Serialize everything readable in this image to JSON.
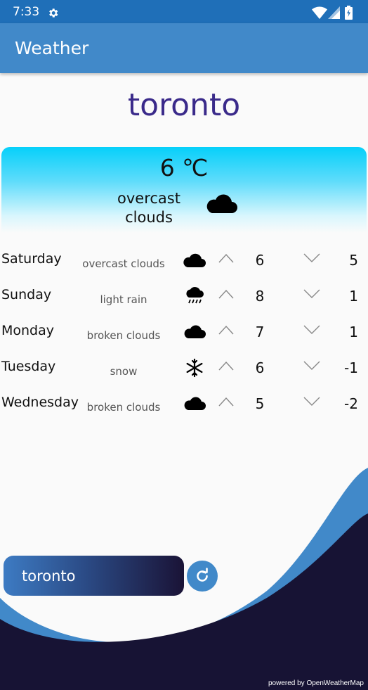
{
  "status_bar": {
    "time": "7:33",
    "icons": [
      "gear-icon",
      "wifi-icon",
      "signal-icon",
      "battery-icon"
    ]
  },
  "app_bar": {
    "title": "Weather"
  },
  "city": "toronto",
  "current": {
    "temperature": "6 ℃",
    "description": "overcast\nclouds",
    "icon": "cloud-icon"
  },
  "forecast": [
    {
      "day": "Saturday",
      "description": "overcast clouds",
      "icon": "cloud-icon",
      "high": "6",
      "low": "5"
    },
    {
      "day": "Sunday",
      "description": "light rain",
      "icon": "rain-cloud-icon",
      "high": "8",
      "low": "1"
    },
    {
      "day": "Monday",
      "description": "broken clouds",
      "icon": "cloud-icon",
      "high": "7",
      "low": "1"
    },
    {
      "day": "Tuesday",
      "description": "snow",
      "icon": "snowflake-icon",
      "high": "6",
      "low": "-1"
    },
    {
      "day": "Wednesday",
      "description": "broken clouds",
      "icon": "cloud-icon",
      "high": "5",
      "low": "-2"
    }
  ],
  "search": {
    "value": "toronto"
  },
  "footer": {
    "credit": "powered by OpenWeatherMap"
  },
  "colors": {
    "status_bar": "#1f6fb8",
    "app_bar": "#4189c9",
    "city_text": "#3a2a8a",
    "wave_blue": "#4189c9",
    "wave_dark": "#171334",
    "card_top": "#06d0fa"
  }
}
